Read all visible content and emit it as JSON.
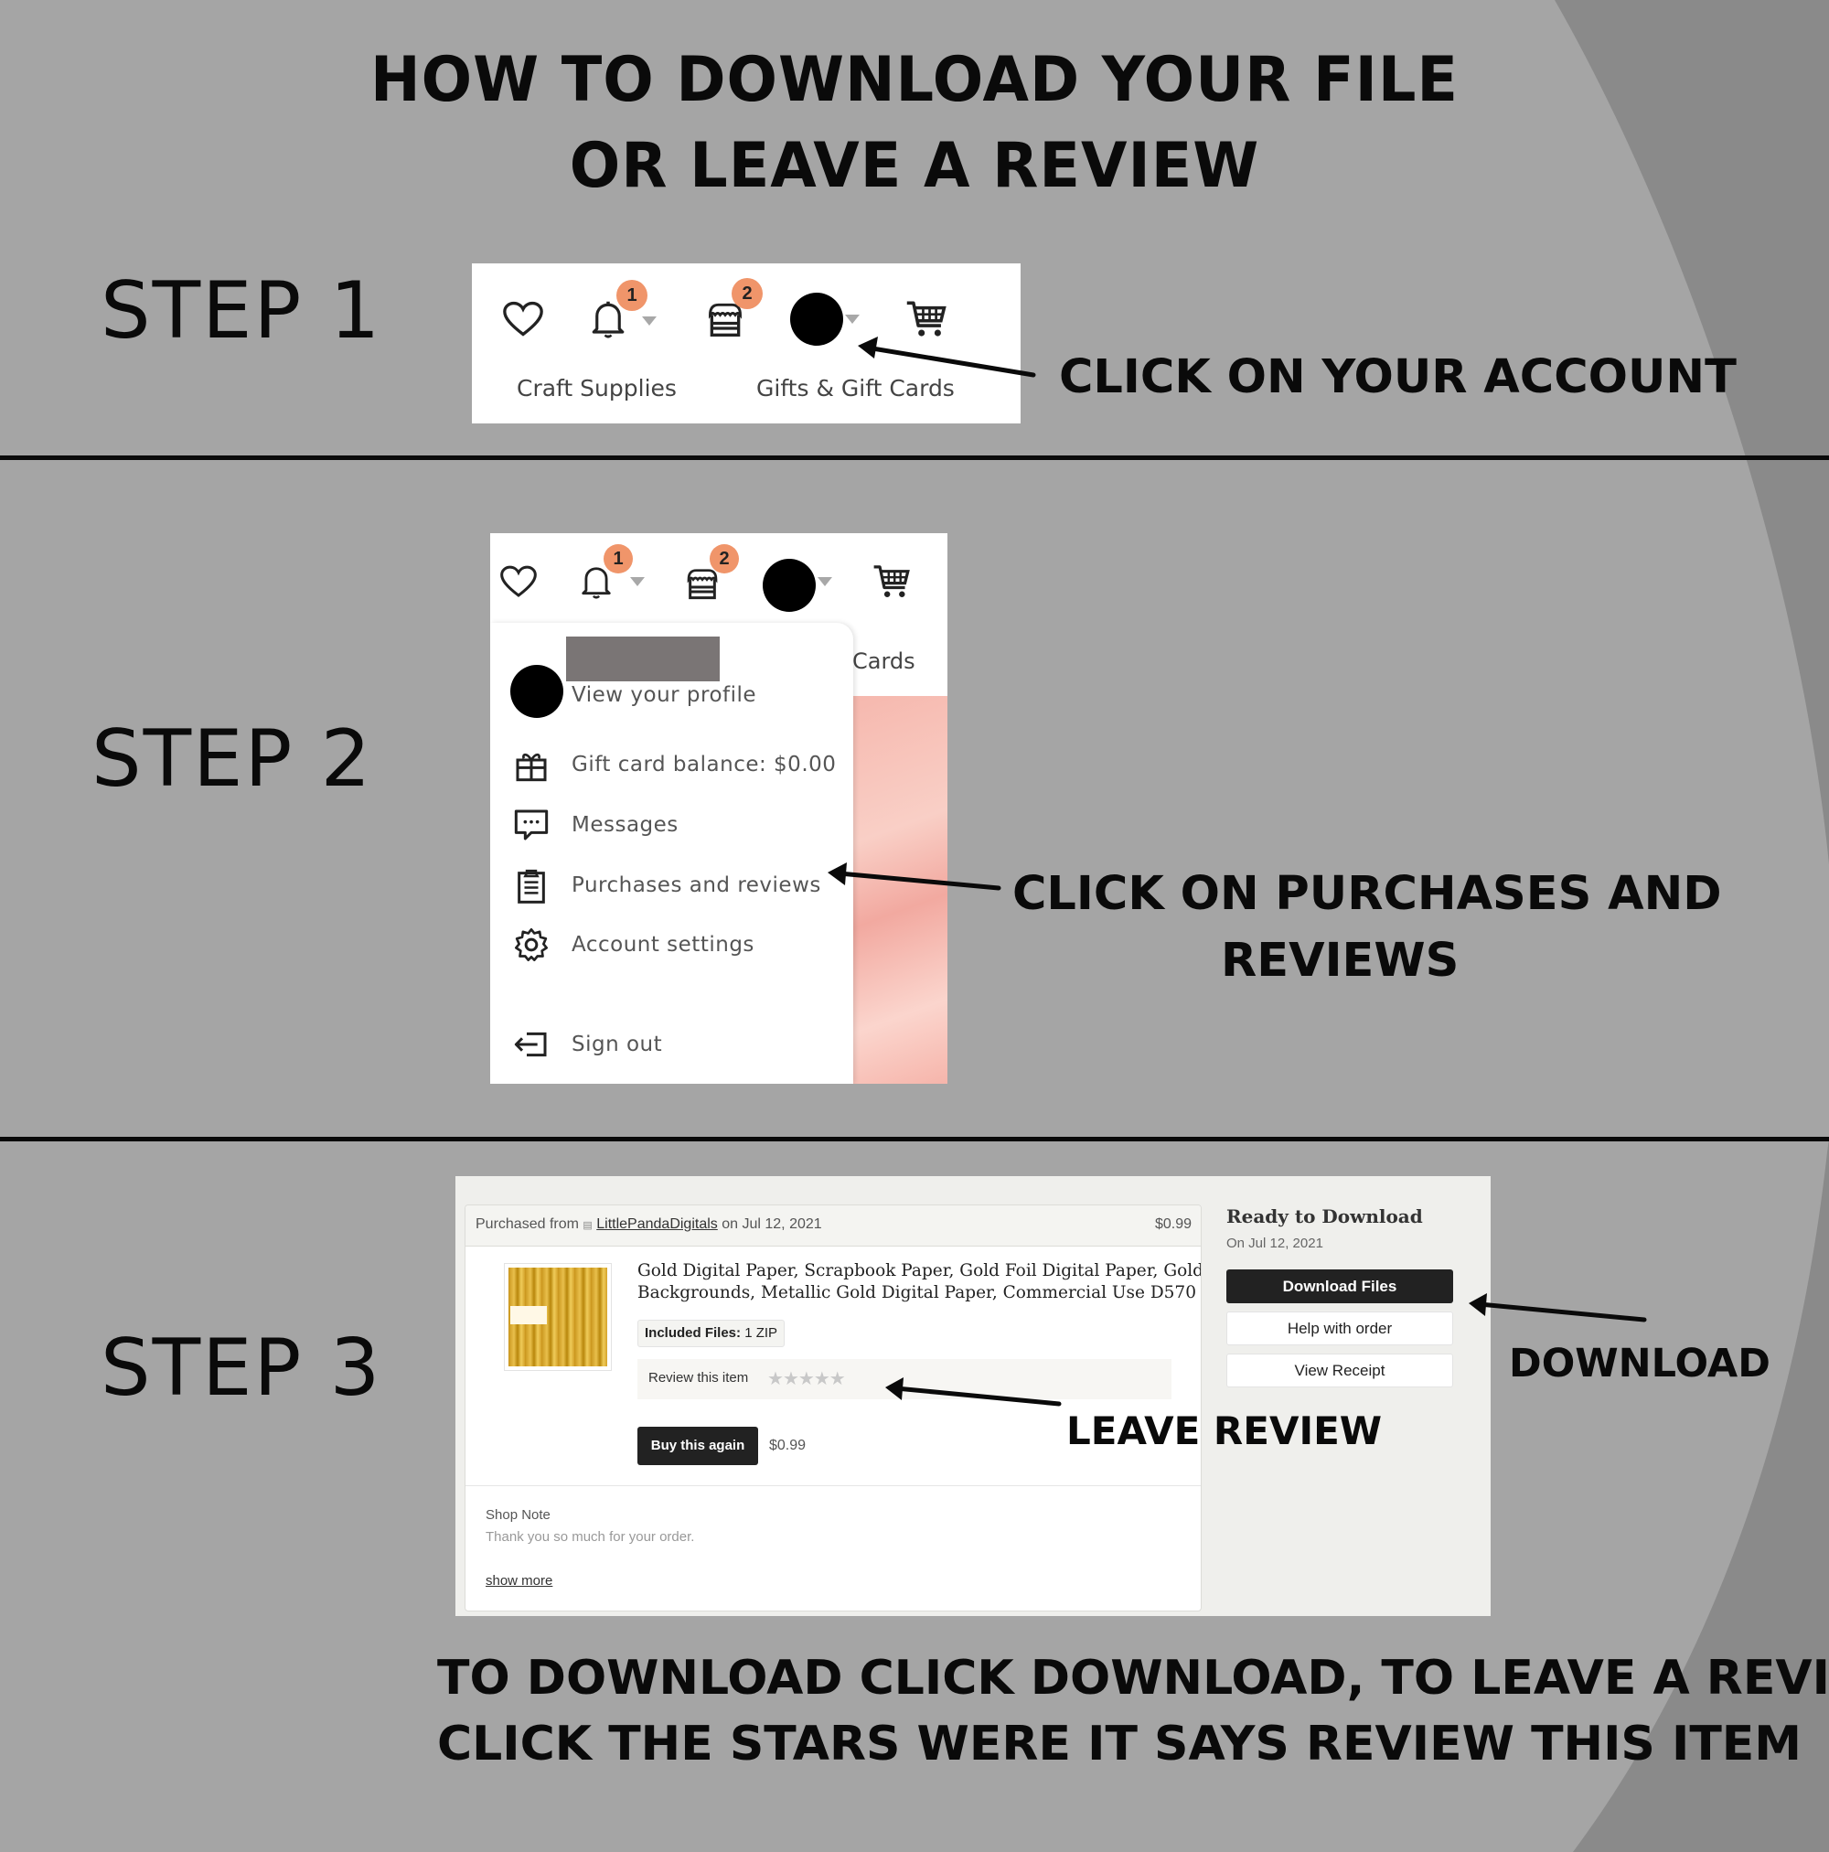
{
  "header": {
    "title_line1": "HOW TO DOWNLOAD YOUR FILE",
    "title_line2": "OR LEAVE A REVIEW"
  },
  "colors": {
    "background": "#a5a5a5",
    "background_curve": "#8a8a8a",
    "badge": "#f0956a",
    "text": "#0a0a0a",
    "button_dark": "#222222"
  },
  "steps": [
    {
      "label": "STEP 1",
      "callout": "CLICK ON YOUR ACCOUNT",
      "navbar": {
        "icons": [
          "heart-icon",
          "bell-icon",
          "shop-icon",
          "account-avatar",
          "cart-icon"
        ],
        "notification_badge": "1",
        "shop_badge": "2",
        "links": [
          "Craft Supplies",
          "Gifts & Gift Cards"
        ]
      }
    },
    {
      "label": "STEP 2",
      "callout_line1": "CLICK ON PURCHASES AND",
      "callout_line2": "REVIEWS",
      "navbar": {
        "notification_badge": "1",
        "shop_badge": "2",
        "partial_link": "Cards"
      },
      "menu": {
        "profile_label": "View your profile",
        "items": [
          {
            "icon": "gift-icon",
            "label": "Gift card balance: $0.00"
          },
          {
            "icon": "message-icon",
            "label": "Messages"
          },
          {
            "icon": "clipboard-icon",
            "label": "Purchases and reviews"
          },
          {
            "icon": "gear-icon",
            "label": "Account settings"
          },
          {
            "icon": "sign-out-icon",
            "label": "Sign out"
          }
        ]
      }
    },
    {
      "label": "STEP 3",
      "callout_download": "DOWNLOAD",
      "callout_review": "LEAVE REVIEW",
      "order": {
        "purchased_from_prefix": "Purchased from",
        "shop_name": "LittlePandaDigitals",
        "purchased_on": "on Jul 12, 2021",
        "header_price": "$0.99",
        "product_title_line1": "Gold Digital Paper, Scrapbook Paper, Gold Foil Digital Paper, Gold",
        "product_title_line2": "Backgrounds, Metallic Gold Digital Paper, Commercial Use D570",
        "included_files_label": "Included Files:",
        "included_files_value": "1 ZIP",
        "review_label": "Review this item",
        "rating_stars": 5,
        "rating_filled": 0,
        "buy_again_label": "Buy this again",
        "buy_again_price": "$0.99",
        "shop_note_title": "Shop Note",
        "shop_note_text": "Thank you so much for your order.",
        "show_more": "show more"
      },
      "download_panel": {
        "title": "Ready to Download",
        "date": "On Jul 12, 2021",
        "download_button": "Download Files",
        "help_button": "Help with order",
        "receipt_button": "View Receipt"
      }
    }
  ],
  "footer": {
    "line1": "TO DOWNLOAD CLICK DOWNLOAD, TO LEAVE A REVIEW",
    "line2": "CLICK THE STARS WERE IT SAYS REVIEW THIS ITEM"
  }
}
